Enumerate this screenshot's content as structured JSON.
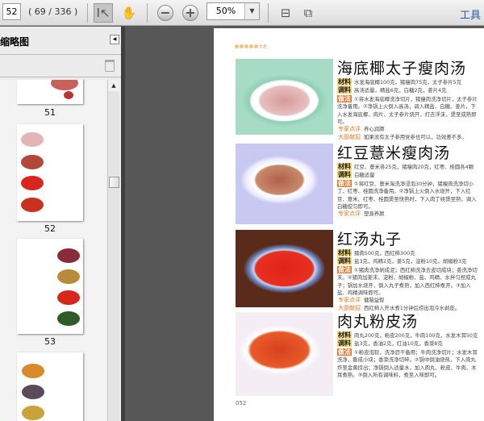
{
  "toolbar": {
    "page_input": "52",
    "page_count": "( 69 / 336 )",
    "zoom": "50%",
    "tools_label": "工具"
  },
  "sidebar": {
    "title": "缩略图",
    "thumbnails": [
      {
        "label": "51"
      },
      {
        "label": "52"
      },
      {
        "label": "53"
      }
    ]
  },
  "page": {
    "header": "大全",
    "page_number": "052",
    "recipes": [
      {
        "title": "海底椰太子瘦肉汤",
        "ingredients_label": "材料",
        "ingredients": "水发海底椰100克，猪瘦肉75克，太子参片5克",
        "seasoning_label": "调料",
        "seasoning": "高汤适量，精盐6克，白糖2克，姜片4克",
        "method_label": "做法",
        "method": "①将水发海底椰洗净切片，猪瘦肉洗净切片，太子参片洗净备用。②净锅上火倒入高汤，调入精盐、白糖、姜片，下入水发海底椰、肉片、太子参片烧开，打去浮沫，煲至成熟即可。",
        "expert_label": "专家点评",
        "expert": "养心润肺",
        "chef_label": "大厨献招",
        "chef": "如果没有太子参用党参也可以，功效差不多。"
      },
      {
        "title": "红豆薏米瘦肉汤",
        "ingredients_label": "材料",
        "ingredients": "红豆、薏米各25克，猪瘦肉20克，红枣、桂圆各4颗",
        "seasoning_label": "调料",
        "seasoning": "白糖适量",
        "method_label": "做法",
        "method": "①将红豆、薏米淘洗净浸泡30分钟，猪瘦肉洗净切小丁，红枣、桂圆洗净备用。②净锅上火倒入水烧开，下入红豆、薏米、红枣、桂圆煲至快熟时，下入肉丁续煲至熟，调入白糖搅匀即可。",
        "expert_label": "专家点评",
        "expert": "塑身养颜"
      },
      {
        "title": "红汤丸子",
        "ingredients_label": "材料",
        "ingredients": "猪肉500克，西红柿300克",
        "seasoning_label": "调料",
        "seasoning": "盐3克，鸡精2克，姜5克，淀粉10克，胡椒粉3克",
        "method_label": "做法",
        "method": "①猪肉洗净剁成泥；西红柿洗净去皮切成块；姜洗净切末。②猪肉加姜末、淀粉、胡椒粉、盐、鸡精、水拌匀捏成丸子；锅加水烧开，倒入丸子煮熟，加入西红柿煮开。③加入盐、鸡精调味即可。",
        "expert_label": "专家点评",
        "expert": "健脑益智",
        "chef_label": "大厨献招",
        "chef": "西红柿入开水煮1分钟后捞出泡冷水剥皮。"
      },
      {
        "title": "肉丸粉皮汤",
        "ingredients_label": "材料",
        "ingredients": "肉丸200克，粉皮200克，牛肉100克，水发木耳50克",
        "seasoning_label": "调料",
        "seasoning": "盐3克，香油2克，红油10克，香菜8克",
        "method_label": "做法",
        "method": "①粉皮泡软，洗净沥干备用；牛肉洗净切片；水发木耳洗净，撕成小块；香菜洗净切碎。②锅中倒油烧热，下入肉丸炸至金黄捞出；净锅倒入适量水，加入肉丸、粉皮、牛肉、木耳煮熟。③倒入所有调味料，煮至入味即可。"
      }
    ]
  }
}
